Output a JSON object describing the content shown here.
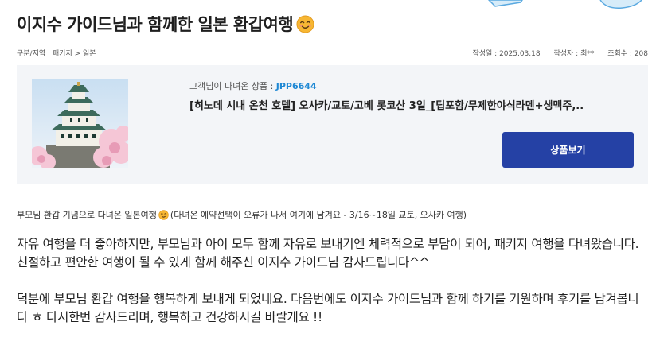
{
  "header": {
    "title": "이지수 가이드님과 함께한 일본 환갑여행",
    "title_emoji": "smiling-face-emoji"
  },
  "meta": {
    "category": "구분/지역 : 패키지 > 일본",
    "date": "작성일 : 2025.03.18",
    "author": "작성자 : 최**",
    "views": "조회수 : 208"
  },
  "product": {
    "label": "고객님이 다녀온 상품 :",
    "code": "JPP6644",
    "name": "[히노데 시내 온천 호텔] 오사카/교토/고베 롯코산 3일_[팁포함/무제한야식라멘+생맥주,..",
    "button_label": "상품보기",
    "thumbnail": "osaka-castle-cherry-blossom-photo",
    "colors": {
      "code": "#1e88d4",
      "button": "#2541a5",
      "box_bg": "#f3f5f8"
    }
  },
  "review": {
    "headline_before": "부모님 환갑 기념으로 다녀온 일본여행",
    "headline_after": "(다녀온 예약선택이 오류가 나서 여기에 남겨요 - 3/16~18일 교토, 오사카 여행)",
    "paragraphs": [
      "자유 여행을 더 좋아하지만, 부모님과 아이 모두 함께 자유로 보내기엔 체력적으로 부담이 되어, 패키지 여행을 다녀왔습니다. 친절하고 편안한 여행이 될 수 있게 함께 해주신 이지수 가이드님 감사드립니다^^",
      "덕분에 부모님 환갑 여행을 행복하게 보내게 되었네요. 다음번에도 이지수 가이드님과 함께 하기를 기원하며 후기를 남겨봅니다 ㅎ 다시한번 감사드리며, 행복하고 건강하시길 바랄게요 !!"
    ]
  }
}
